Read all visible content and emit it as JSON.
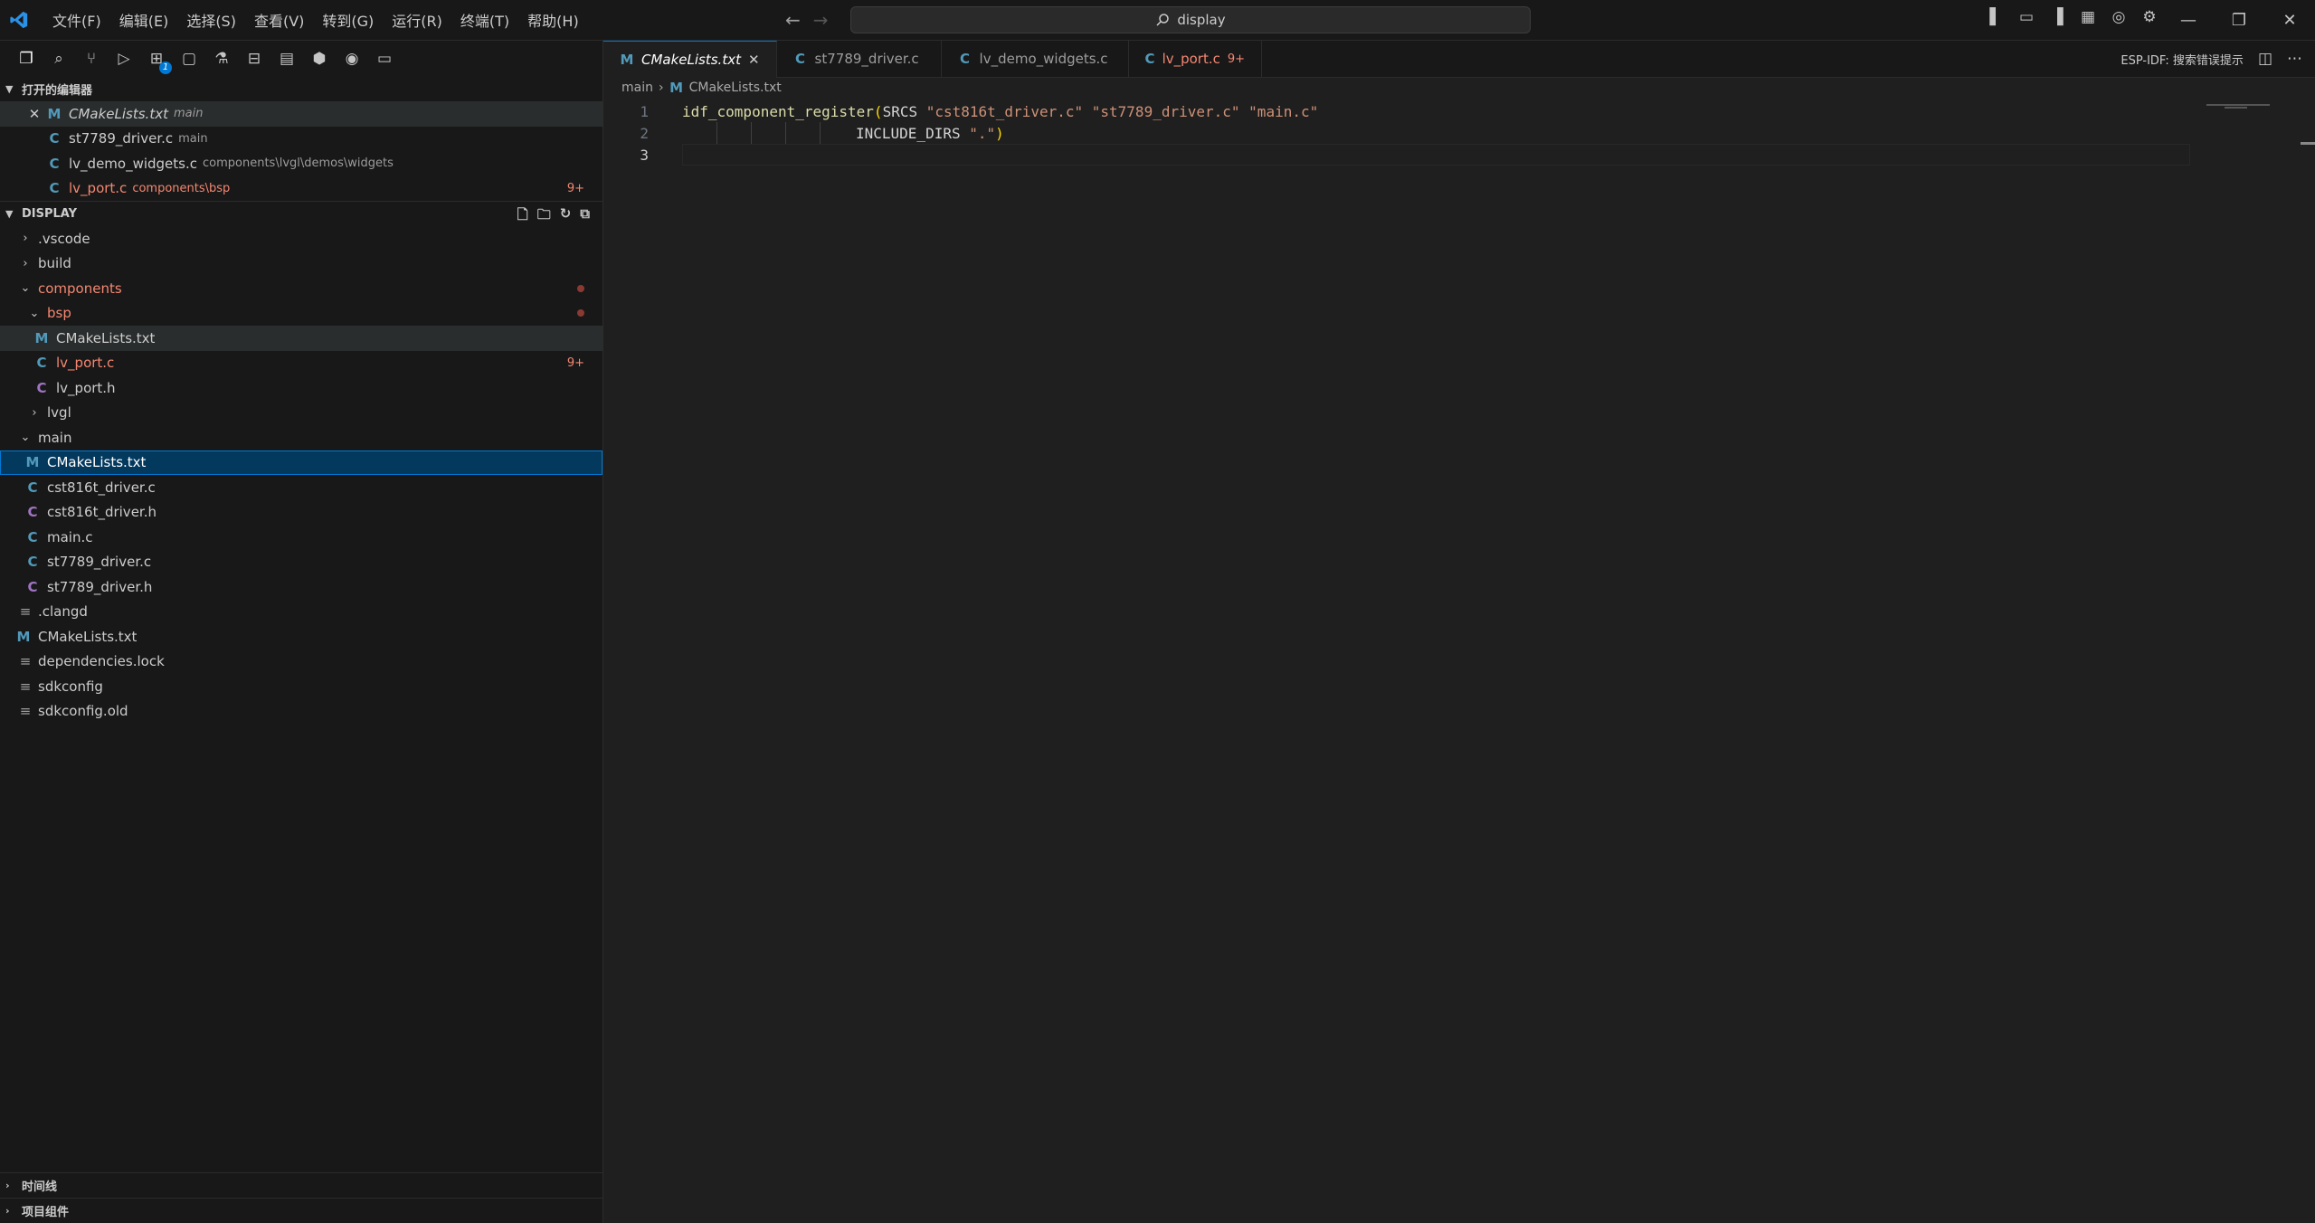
{
  "menu": [
    "文件(F)",
    "编辑(E)",
    "选择(S)",
    "查看(V)",
    "转到(G)",
    "运行(R)",
    "终端(T)",
    "帮助(H)"
  ],
  "search": {
    "text": "display"
  },
  "activity_badge": "1",
  "open_editors": {
    "title": "打开的编辑器",
    "items": [
      {
        "name": "CMakeLists.txt",
        "desc": "main",
        "icon": "M"
      },
      {
        "name": "st7789_driver.c",
        "desc": "main",
        "icon": "C"
      },
      {
        "name": "lv_demo_widgets.c",
        "desc": "components\\lvgl\\demos\\widgets",
        "icon": "C"
      },
      {
        "name": "lv_port.c",
        "desc": "components\\bsp",
        "icon": "C",
        "count": "9+"
      }
    ]
  },
  "explorer": {
    "title": "DISPLAY",
    "items": [
      {
        "name": ".vscode"
      },
      {
        "name": "build"
      },
      {
        "name": "components"
      },
      {
        "name": "bsp"
      },
      {
        "name": "CMakeLists.txt"
      },
      {
        "name": "lv_port.c",
        "count": "9+"
      },
      {
        "name": "lv_port.h"
      },
      {
        "name": "lvgl"
      },
      {
        "name": "main"
      },
      {
        "name": "CMakeLists.txt"
      },
      {
        "name": "cst816t_driver.c"
      },
      {
        "name": "cst816t_driver.h"
      },
      {
        "name": "main.c"
      },
      {
        "name": "st7789_driver.c"
      },
      {
        "name": "st7789_driver.h"
      },
      {
        "name": ".clangd"
      },
      {
        "name": "CMakeLists.txt"
      },
      {
        "name": "dependencies.lock"
      },
      {
        "name": "sdkconfig"
      },
      {
        "name": "sdkconfig.old"
      }
    ]
  },
  "bottom_sections": [
    "时间线",
    "项目组件"
  ],
  "tabs": [
    {
      "label": "CMakeLists.txt",
      "icon": "M"
    },
    {
      "label": "st7789_driver.c",
      "icon": "C"
    },
    {
      "label": "lv_demo_widgets.c",
      "icon": "C"
    },
    {
      "label": "lv_port.c",
      "icon": "C",
      "count": "9+"
    }
  ],
  "esp_idf_label": "ESP-IDF:",
  "esp_idf_action": "搜索错误提示",
  "breadcrumb": [
    "main",
    "CMakeLists.txt"
  ],
  "code": {
    "line_numbers": [
      "1",
      "2",
      "3"
    ],
    "line1": {
      "fn": "idf_component_register",
      "open": "(",
      "kw": "SRCS ",
      "s1": "\"cst816t_driver.c\"",
      "sp1": " ",
      "s2": "\"st7789_driver.c\"",
      "sp2": " ",
      "s3": "\"main.c\""
    },
    "line2": {
      "kw": "INCLUDE_DIRS ",
      "s1": "\".\"",
      "close": ")"
    }
  }
}
